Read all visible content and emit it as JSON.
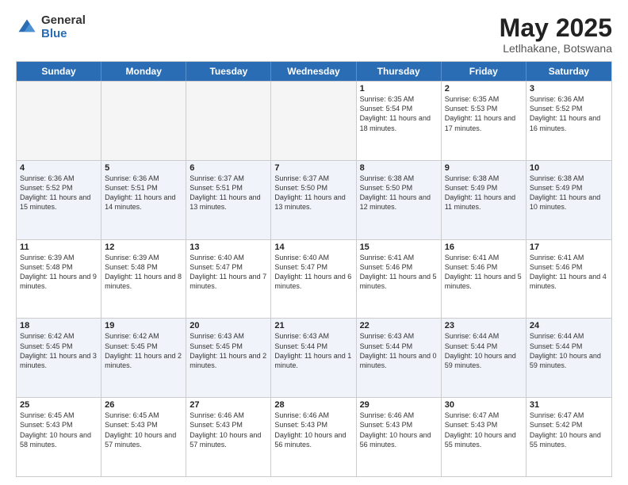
{
  "logo": {
    "general": "General",
    "blue": "Blue"
  },
  "title": "May 2025",
  "subtitle": "Letlhakane, Botswana",
  "header_days": [
    "Sunday",
    "Monday",
    "Tuesday",
    "Wednesday",
    "Thursday",
    "Friday",
    "Saturday"
  ],
  "rows": [
    [
      {
        "day": "",
        "info": "",
        "empty": true
      },
      {
        "day": "",
        "info": "",
        "empty": true
      },
      {
        "day": "",
        "info": "",
        "empty": true
      },
      {
        "day": "",
        "info": "",
        "empty": true
      },
      {
        "day": "1",
        "info": "Sunrise: 6:35 AM\nSunset: 5:54 PM\nDaylight: 11 hours and 18 minutes.",
        "empty": false
      },
      {
        "day": "2",
        "info": "Sunrise: 6:35 AM\nSunset: 5:53 PM\nDaylight: 11 hours and 17 minutes.",
        "empty": false
      },
      {
        "day": "3",
        "info": "Sunrise: 6:36 AM\nSunset: 5:52 PM\nDaylight: 11 hours and 16 minutes.",
        "empty": false
      }
    ],
    [
      {
        "day": "4",
        "info": "Sunrise: 6:36 AM\nSunset: 5:52 PM\nDaylight: 11 hours and 15 minutes.",
        "empty": false
      },
      {
        "day": "5",
        "info": "Sunrise: 6:36 AM\nSunset: 5:51 PM\nDaylight: 11 hours and 14 minutes.",
        "empty": false
      },
      {
        "day": "6",
        "info": "Sunrise: 6:37 AM\nSunset: 5:51 PM\nDaylight: 11 hours and 13 minutes.",
        "empty": false
      },
      {
        "day": "7",
        "info": "Sunrise: 6:37 AM\nSunset: 5:50 PM\nDaylight: 11 hours and 13 minutes.",
        "empty": false
      },
      {
        "day": "8",
        "info": "Sunrise: 6:38 AM\nSunset: 5:50 PM\nDaylight: 11 hours and 12 minutes.",
        "empty": false
      },
      {
        "day": "9",
        "info": "Sunrise: 6:38 AM\nSunset: 5:49 PM\nDaylight: 11 hours and 11 minutes.",
        "empty": false
      },
      {
        "day": "10",
        "info": "Sunrise: 6:38 AM\nSunset: 5:49 PM\nDaylight: 11 hours and 10 minutes.",
        "empty": false
      }
    ],
    [
      {
        "day": "11",
        "info": "Sunrise: 6:39 AM\nSunset: 5:48 PM\nDaylight: 11 hours and 9 minutes.",
        "empty": false
      },
      {
        "day": "12",
        "info": "Sunrise: 6:39 AM\nSunset: 5:48 PM\nDaylight: 11 hours and 8 minutes.",
        "empty": false
      },
      {
        "day": "13",
        "info": "Sunrise: 6:40 AM\nSunset: 5:47 PM\nDaylight: 11 hours and 7 minutes.",
        "empty": false
      },
      {
        "day": "14",
        "info": "Sunrise: 6:40 AM\nSunset: 5:47 PM\nDaylight: 11 hours and 6 minutes.",
        "empty": false
      },
      {
        "day": "15",
        "info": "Sunrise: 6:41 AM\nSunset: 5:46 PM\nDaylight: 11 hours and 5 minutes.",
        "empty": false
      },
      {
        "day": "16",
        "info": "Sunrise: 6:41 AM\nSunset: 5:46 PM\nDaylight: 11 hours and 5 minutes.",
        "empty": false
      },
      {
        "day": "17",
        "info": "Sunrise: 6:41 AM\nSunset: 5:46 PM\nDaylight: 11 hours and 4 minutes.",
        "empty": false
      }
    ],
    [
      {
        "day": "18",
        "info": "Sunrise: 6:42 AM\nSunset: 5:45 PM\nDaylight: 11 hours and 3 minutes.",
        "empty": false
      },
      {
        "day": "19",
        "info": "Sunrise: 6:42 AM\nSunset: 5:45 PM\nDaylight: 11 hours and 2 minutes.",
        "empty": false
      },
      {
        "day": "20",
        "info": "Sunrise: 6:43 AM\nSunset: 5:45 PM\nDaylight: 11 hours and 2 minutes.",
        "empty": false
      },
      {
        "day": "21",
        "info": "Sunrise: 6:43 AM\nSunset: 5:44 PM\nDaylight: 11 hours and 1 minute.",
        "empty": false
      },
      {
        "day": "22",
        "info": "Sunrise: 6:43 AM\nSunset: 5:44 PM\nDaylight: 11 hours and 0 minutes.",
        "empty": false
      },
      {
        "day": "23",
        "info": "Sunrise: 6:44 AM\nSunset: 5:44 PM\nDaylight: 10 hours and 59 minutes.",
        "empty": false
      },
      {
        "day": "24",
        "info": "Sunrise: 6:44 AM\nSunset: 5:44 PM\nDaylight: 10 hours and 59 minutes.",
        "empty": false
      }
    ],
    [
      {
        "day": "25",
        "info": "Sunrise: 6:45 AM\nSunset: 5:43 PM\nDaylight: 10 hours and 58 minutes.",
        "empty": false
      },
      {
        "day": "26",
        "info": "Sunrise: 6:45 AM\nSunset: 5:43 PM\nDaylight: 10 hours and 57 minutes.",
        "empty": false
      },
      {
        "day": "27",
        "info": "Sunrise: 6:46 AM\nSunset: 5:43 PM\nDaylight: 10 hours and 57 minutes.",
        "empty": false
      },
      {
        "day": "28",
        "info": "Sunrise: 6:46 AM\nSunset: 5:43 PM\nDaylight: 10 hours and 56 minutes.",
        "empty": false
      },
      {
        "day": "29",
        "info": "Sunrise: 6:46 AM\nSunset: 5:43 PM\nDaylight: 10 hours and 56 minutes.",
        "empty": false
      },
      {
        "day": "30",
        "info": "Sunrise: 6:47 AM\nSunset: 5:43 PM\nDaylight: 10 hours and 55 minutes.",
        "empty": false
      },
      {
        "day": "31",
        "info": "Sunrise: 6:47 AM\nSunset: 5:42 PM\nDaylight: 10 hours and 55 minutes.",
        "empty": false
      }
    ]
  ]
}
